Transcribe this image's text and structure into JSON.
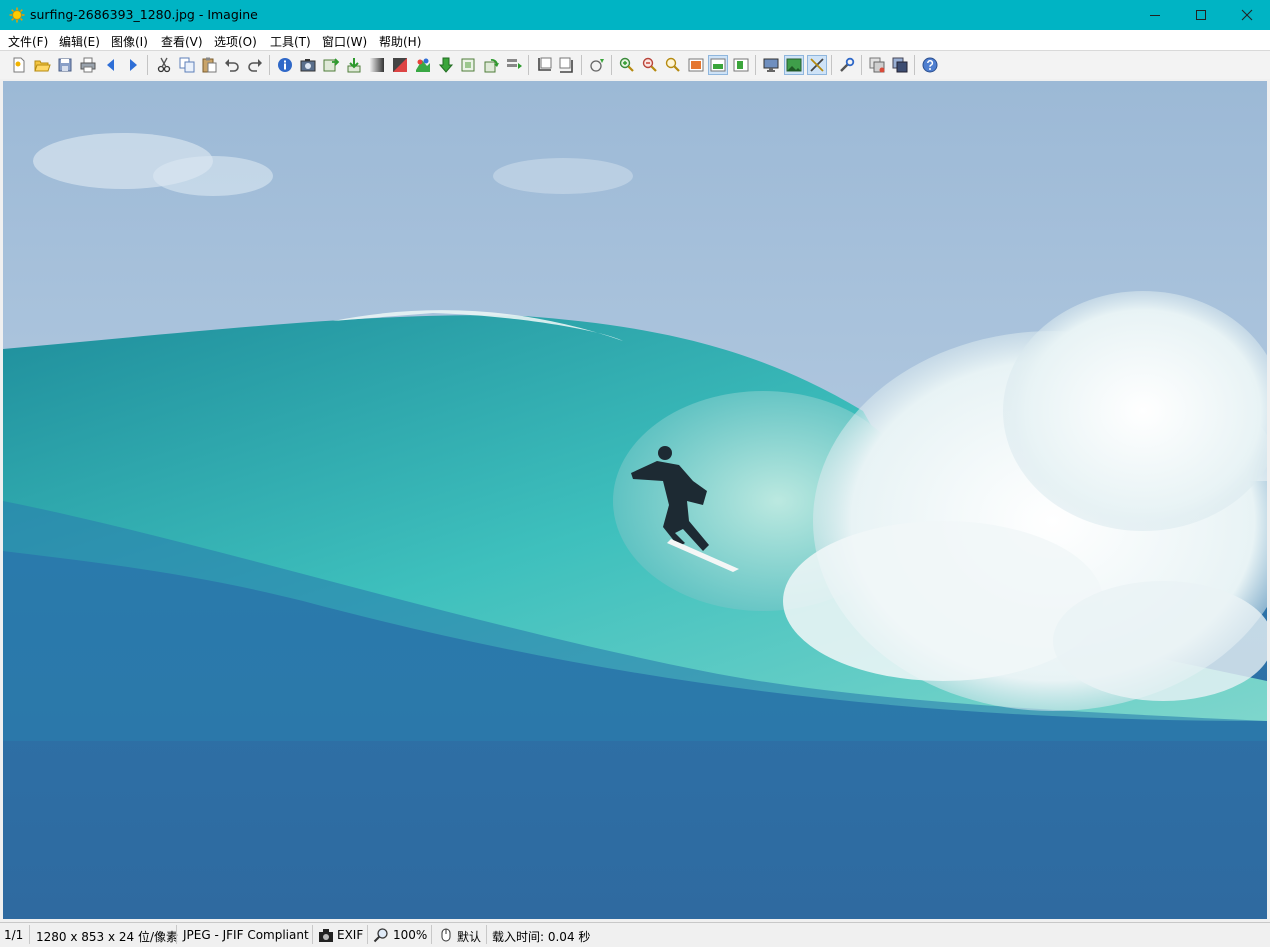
{
  "window": {
    "title": "surfing-2686393_1280.jpg - Imagine",
    "app_icon": "sun-icon",
    "controls": [
      "minimize-icon",
      "maximize-icon",
      "close-icon"
    ]
  },
  "menu": {
    "file": "文件(F)",
    "edit": "编辑(E)",
    "image": "图像(I)",
    "view": "查看(V)",
    "options": "选项(O)",
    "tools": "工具(T)",
    "window": "窗口(W)",
    "help": "帮助(H)"
  },
  "toolbar": {
    "icons": [
      "new-icon",
      "open-icon",
      "save-icon",
      "print-icon",
      "prev-icon",
      "next-icon",
      "cut-icon",
      "copy-icon",
      "paste-icon",
      "undo-icon",
      "redo-icon",
      "info-icon",
      "camera-icon",
      "export-icon",
      "import-icon",
      "grayscale-icon",
      "negative-icon",
      "color-icon",
      "down-arrow-icon",
      "resize-icon",
      "rotate-icon",
      "batch-icon",
      "crop-icon",
      "crop-alt-icon",
      "effect-icon",
      "zoom-in-icon",
      "zoom-out-icon",
      "zoom-search-icon",
      "fit-window-icon",
      "fit-width-icon",
      "fit-height-icon",
      "monitor-icon",
      "slideshow-icon",
      "fullscreen-icon",
      "tools-icon",
      "plugins-icon",
      "filter-icon",
      "help-icon"
    ],
    "pressed": [
      "fit-width-icon",
      "slideshow-icon",
      "fullscreen-icon"
    ]
  },
  "image": {
    "subject": "surfer riding inside a turquoise barrel wave"
  },
  "status": {
    "page": "1/1",
    "dimensions": "1280 x 853 x 24 位/像素",
    "format": "JPEG - JFIF Compliant",
    "exif": "EXIF",
    "zoom": "100%",
    "mode": "默认",
    "load_time": "载入时间: 0.04 秒"
  },
  "colors": {
    "titlebar": "#00b4c4",
    "toolbar": "#f3f3f3",
    "statusbar": "#f0f0f0",
    "sky": "#a9c6df",
    "wave": "#2fb4b6",
    "sea": "#2f73a8"
  }
}
